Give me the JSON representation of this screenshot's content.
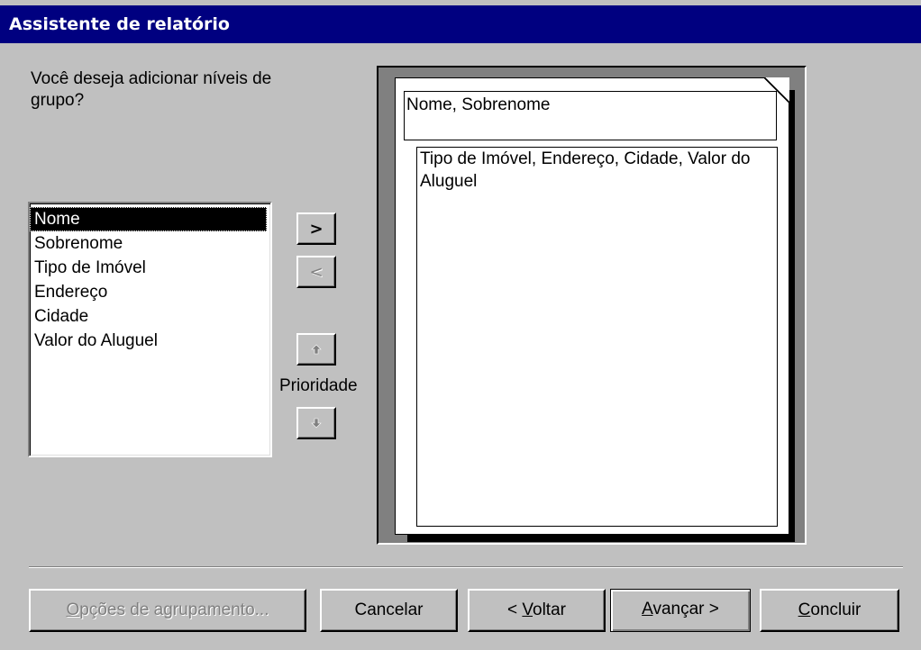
{
  "window": {
    "title": "Assistente de relatório"
  },
  "question": "Você deseja adicionar níveis de grupo?",
  "fields": [
    {
      "label": "Nome",
      "selected": true
    },
    {
      "label": "Sobrenome",
      "selected": false
    },
    {
      "label": "Tipo de Imóvel",
      "selected": false
    },
    {
      "label": "Endereço",
      "selected": false
    },
    {
      "label": "Cidade",
      "selected": false
    },
    {
      "label": "Valor do Aluguel",
      "selected": false
    }
  ],
  "controls": {
    "add_label": ">",
    "remove_label": "<",
    "priority_label": "Prioridade"
  },
  "preview": {
    "group_header": "Nome, Sobrenome",
    "detail_fields": "Tipo de Imóvel, Endereço, Cidade, Valor do Aluguel"
  },
  "buttons": {
    "grouping_options": {
      "mnemonic": "O",
      "rest": "pções de agrupamento..."
    },
    "cancel": "Cancelar",
    "back": {
      "prefix": "< ",
      "mnemonic": "V",
      "rest": "oltar"
    },
    "next": {
      "mnemonic": "A",
      "rest": "vançar >"
    },
    "finish": {
      "mnemonic": "C",
      "rest": "oncluir"
    }
  }
}
